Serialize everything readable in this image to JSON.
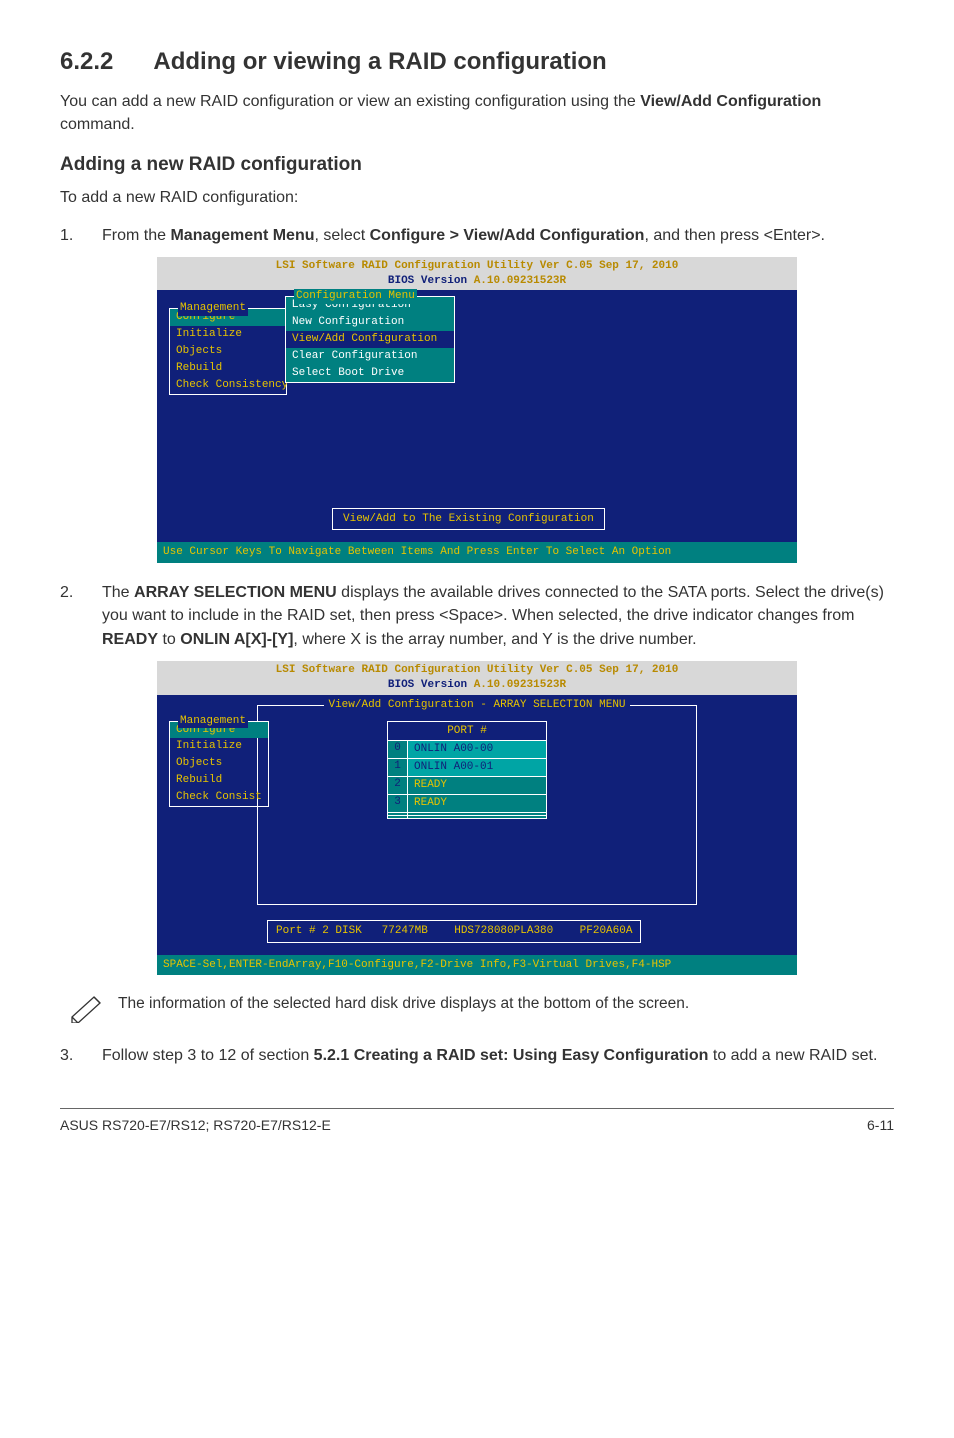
{
  "section": {
    "number": "6.2.2",
    "title": "Adding or viewing a RAID configuration"
  },
  "intro": {
    "pre": "You can add a new RAID configuration or view an existing configuration using the ",
    "bold": "View/Add Configuration",
    "post": " command."
  },
  "subhead": "Adding a new RAID configuration",
  "lead": "To add a new RAID configuration:",
  "step1": {
    "num": "1.",
    "pre": "From the ",
    "b1": "Management Menu",
    "mid1": ", select ",
    "b2": "Configure > View/Add Configuration",
    "post": ", and then press <Enter>."
  },
  "bios1": {
    "title_yellow": "LSI Software RAID Configuration Utility Ver C.05 Sep 17, 2010",
    "title_sub_pre": "BIOS Version  ",
    "title_sub_val": "A.10.09231523R",
    "mgmt_label": "Management",
    "mgmt_items": [
      "Configure",
      "Initialize",
      "Objects",
      "Rebuild",
      "Check Consistency"
    ],
    "cfg_label": "Configuration Menu",
    "cfg_items": [
      "Easy Configuration",
      "New Configuration",
      "View/Add Configuration",
      "Clear Configuration",
      "Select Boot Drive"
    ],
    "center": "View/Add to The Existing Configuration",
    "status": "Use Cursor Keys To Navigate Between Items And Press Enter To Select An Option"
  },
  "step2": {
    "num": "2.",
    "p1": "The ",
    "b1": "ARRAY SELECTION MENU",
    "p2": " displays the available drives connected to the SATA ports. Select the drive(s) you want to include in the RAID set, then press <Space>. When selected, the drive indicator changes from ",
    "b2": "READY",
    "p3": " to ",
    "b3": "ONLIN A[X]-[Y]",
    "p4": ", where X is the array number, and Y is the drive number."
  },
  "bios2": {
    "title_yellow": "LSI Software RAID Configuration Utility Ver C.05 Sep 17, 2010",
    "title_sub_pre": "BIOS Version  ",
    "title_sub_val": "A.10.09231523R",
    "sel_label": "View/Add Configuration - ARRAY SELECTION MENU",
    "mgmt_label": "Management",
    "mgmt_items": [
      "Configure",
      "Initialize",
      "Objects",
      "Rebuild",
      "Check Consist"
    ],
    "port_hdr": "PORT #",
    "drives": [
      {
        "idx": "0",
        "val": "ONLIN A00-00",
        "cls": "teal-light"
      },
      {
        "idx": "1",
        "val": "ONLIN A00-01",
        "cls": "teal-light"
      },
      {
        "idx": "2",
        "val": "READY",
        "cls": "teal-dark"
      },
      {
        "idx": "3",
        "val": "READY",
        "cls": "teal-dark"
      },
      {
        "idx": "",
        "val": "",
        "cls": "teal-empty"
      },
      {
        "idx": "",
        "val": "",
        "cls": "teal-empty"
      }
    ],
    "bottom": "Port # 2 DISK   77247MB    HDS728080PLA380    PF20A60A",
    "status": "SPACE-Sel,ENTER-EndArray,F10-Configure,F2-Drive Info,F3-Virtual Drives,F4-HSP"
  },
  "note_text": "The information of the selected hard disk drive displays at the bottom of the screen.",
  "step3": {
    "num": "3.",
    "p1": "Follow step 3 to 12 of section ",
    "b1": "5.2.1 Creating a RAID set: Using Easy Configuration",
    "p2": " to add a new RAID set."
  },
  "footer": {
    "left": "ASUS RS720-E7/RS12; RS720-E7/RS12-E",
    "right": "6-11"
  }
}
